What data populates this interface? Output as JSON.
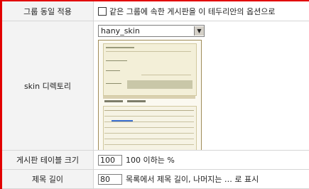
{
  "rows": {
    "group": {
      "label": "그룹 동일 적용",
      "option": "같은 그룹에 속한 게시판을 이 테두리안의 옵션으로"
    },
    "skin": {
      "label": "skin 디렉토리",
      "selected": "hany_skin"
    },
    "table_size": {
      "label": "게시판 테이블 크기",
      "value": "100",
      "suffix": "100 이하는 %"
    },
    "title_length": {
      "label": "제목 길이",
      "value": "80",
      "suffix": "목록에서 제목 길이, 나머지는 … 로 표시"
    }
  },
  "colors": {
    "accent": "#e20000",
    "label_bg": "#f3f3f3"
  }
}
